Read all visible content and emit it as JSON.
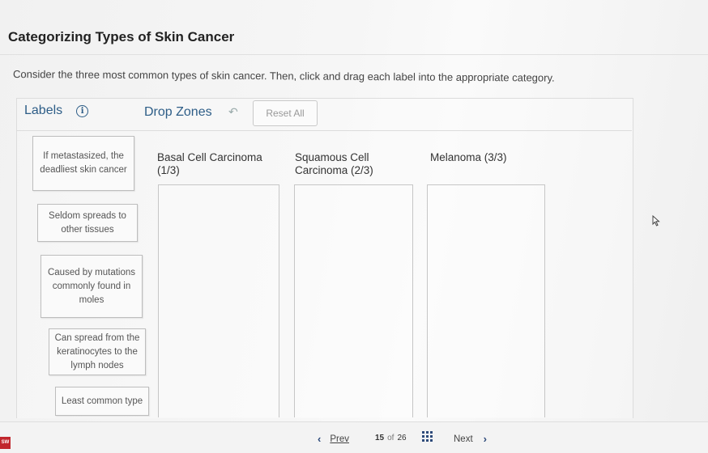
{
  "page": {
    "title": "Categorizing Types of Skin Cancer",
    "instructions": "Consider the three most common types of skin cancer. Then, click and drag each label into the appropriate category."
  },
  "toolbar": {
    "labels_heading": "Labels",
    "info_icon": "info-icon",
    "drop_zones_heading": "Drop Zones",
    "undo_icon": "undo-icon",
    "reset_label": "Reset All"
  },
  "labels": [
    "If metastasized, the deadliest skin cancer",
    "Seldom spreads to other tissues",
    "Caused by mutations commonly found in moles",
    "Can spread from the keratinocytes to the lymph nodes",
    "Least common type"
  ],
  "zones": [
    {
      "title": "Basal Cell Carcinoma",
      "count": "(1/3)"
    },
    {
      "title": "Squamous Cell Carcinoma",
      "count": "(2/3)"
    },
    {
      "title": "Melanoma",
      "count": "(3/3)"
    }
  ],
  "footer": {
    "prev_label": "Prev",
    "current_page": "15",
    "of_label": "of",
    "total_pages": "26",
    "grid_icon": "grid-icon",
    "next_label": "Next",
    "brand_logo_text": "SW"
  },
  "colors": {
    "accent": "#2d5d87",
    "nav": "#2d4a7a",
    "brand": "#c1272d"
  }
}
